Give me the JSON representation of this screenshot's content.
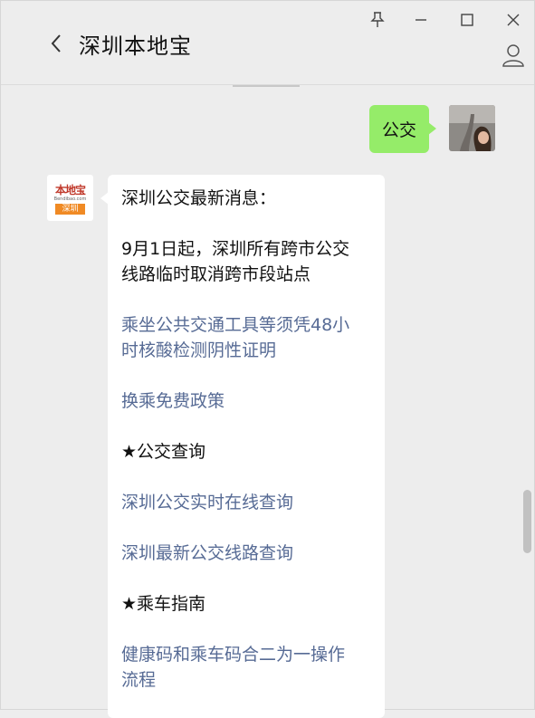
{
  "header": {
    "title": "深圳本地宝"
  },
  "chat": {
    "sent": {
      "text": "公交"
    },
    "received": {
      "avatar": {
        "logo_text": "本地宝",
        "url_text": "Bendibao.com",
        "badge": "深圳"
      },
      "lines": [
        {
          "text": "深圳公交最新消息：",
          "link": false
        },
        {
          "text": "9月1日起，深圳所有跨市公交",
          "link": false
        },
        {
          "text": "线路临时取消跨市段站点",
          "link": false
        },
        {
          "text": "乘坐公共交通工具等须凭48小",
          "link": true
        },
        {
          "text": "时核酸检测阴性证明",
          "link": true
        },
        {
          "text": "换乘免费政策",
          "link": true
        },
        {
          "text": "★公交查询",
          "link": false
        },
        {
          "text": "深圳公交实时在线查询",
          "link": true
        },
        {
          "text": "深圳最新公交线路查询",
          "link": true
        },
        {
          "text": "★乘车指南",
          "link": false
        },
        {
          "text": "健康码和乘车码合二为一操作",
          "link": true
        },
        {
          "text": "流程",
          "link": true
        }
      ]
    }
  },
  "colors": {
    "sent_bubble": "#95ec69",
    "link": "#576b95",
    "background": "#ededed"
  }
}
